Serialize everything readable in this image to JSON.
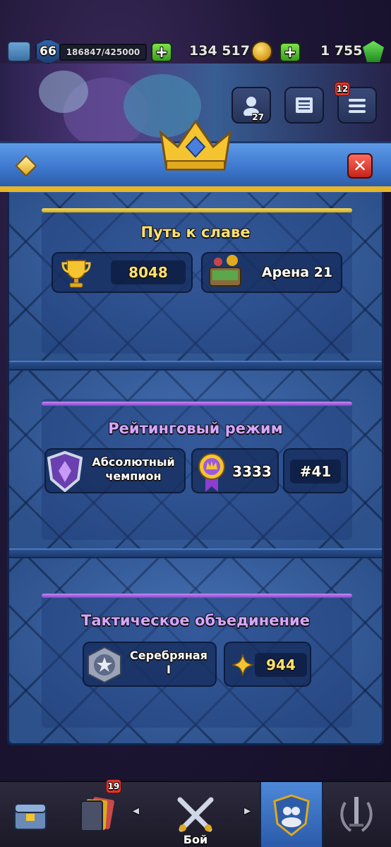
{
  "hud": {
    "level": "66",
    "xp": "186847/425000",
    "gold": "134 517",
    "gems": "1 755",
    "plus_label": "+"
  },
  "side_buttons": {
    "friends_count": "27",
    "menu_badge": "12"
  },
  "panel": {
    "close_label": "✕",
    "path_of_legends": {
      "title": "Путь к славе",
      "trophies": "8048",
      "arena": "Арена 21"
    },
    "ranked": {
      "title": "Рейтинговый режим",
      "league_line1": "Абсолютный",
      "league_line2": "чемпион",
      "rating": "3333",
      "rank": "#41"
    },
    "merge_tactics": {
      "title": "Тактическое объединение",
      "league_line1": "Серебряная",
      "league_line2": "I",
      "points": "944"
    }
  },
  "bottom_nav": {
    "cards_badge": "19",
    "battle_label": "Бой",
    "left_arrow": "◂",
    "right_arrow": "▸"
  },
  "colors": {
    "gold_line": "#e6c23a",
    "purple_line": "#a35be0",
    "accent_blue": "#3460a6"
  }
}
